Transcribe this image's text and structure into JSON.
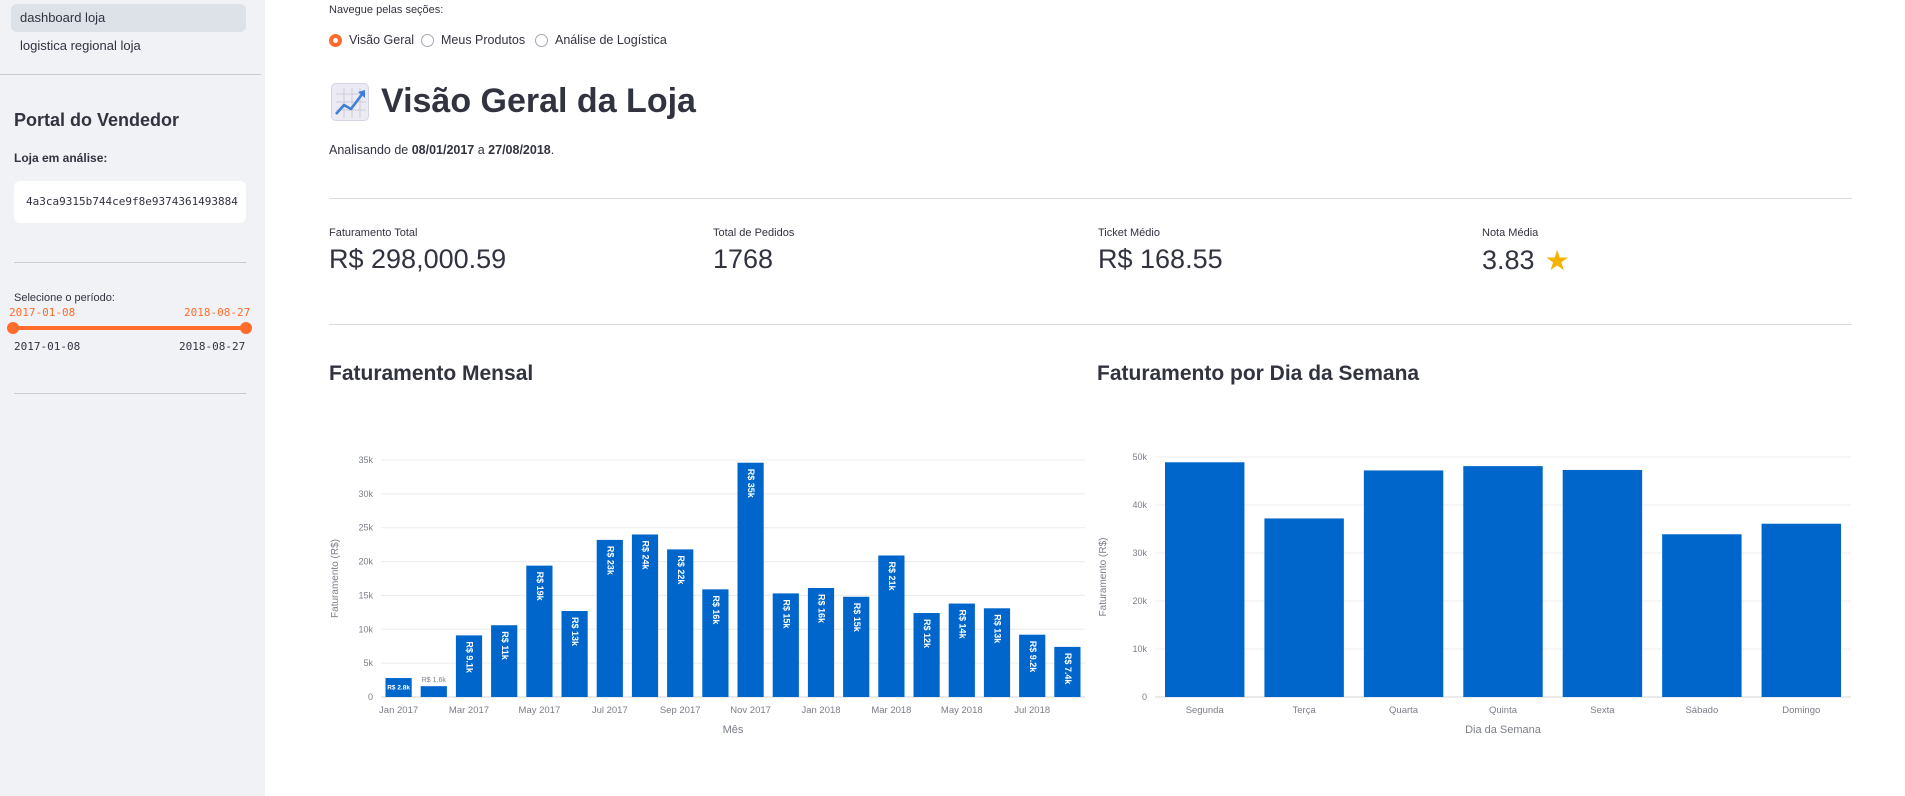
{
  "sidebar": {
    "nav": [
      "dashboard loja",
      "logistica regional loja"
    ],
    "portal_title": "Portal do Vendedor",
    "store_label": "Loja em análise:",
    "store_id": "4a3ca9315b744ce9f8e9374361493884",
    "period_label": "Selecione o período:",
    "slider": {
      "start": "2017-01-08",
      "end": "2018-08-27",
      "min": "2017-01-08",
      "max": "2018-08-27"
    }
  },
  "main": {
    "nav_hint": "Navegue pelas seções:",
    "sections": [
      "Visão Geral",
      "Meus Produtos",
      "Análise de Logística"
    ],
    "selected_section": "Visão Geral",
    "title": "Visão Geral da Loja",
    "period_prefix": "Analisando de ",
    "period_start": "08/01/2017",
    "period_mid": " a ",
    "period_end": "27/08/2018",
    "period_suffix": ".",
    "metrics": [
      {
        "label": "Faturamento Total",
        "value": "R$ 298,000.59"
      },
      {
        "label": "Total de Pedidos",
        "value": "1768"
      },
      {
        "label": "Ticket Médio",
        "value": "R$ 168.55"
      },
      {
        "label": "Nota Média",
        "value": "3.83"
      }
    ],
    "chart_titles": [
      "Faturamento Mensal",
      "Faturamento por Dia da Semana"
    ]
  },
  "colors": {
    "accent": "#ff6c2c",
    "bar": "#0066cc",
    "sidebar_bg": "#f0f2f6"
  },
  "icons": {
    "title_icon": "chart-increasing-icon",
    "rating_icon": "star-icon"
  },
  "chart_data": [
    {
      "type": "bar",
      "title": "Faturamento Mensal",
      "xlabel": "Mês",
      "ylabel": "Faturamento (R$)",
      "ylim": [
        0,
        35000
      ],
      "yticks": [
        0,
        5000,
        10000,
        15000,
        20000,
        25000,
        30000,
        35000
      ],
      "ytick_labels": [
        "0",
        "5k",
        "10k",
        "15k",
        "20k",
        "25k",
        "30k",
        "35k"
      ],
      "categories": [
        "2017-01",
        "2017-02",
        "2017-03",
        "2017-04",
        "2017-05",
        "2017-06",
        "2017-07",
        "2017-08",
        "2017-09",
        "2017-10",
        "2017-11",
        "2017-12",
        "2018-01",
        "2018-02",
        "2018-03",
        "2018-04",
        "2018-05",
        "2018-06",
        "2018-07",
        "2018-08"
      ],
      "xtick_labels": [
        "Jan 2017",
        "",
        "Mar 2017",
        "",
        "May 2017",
        "",
        "Jul 2017",
        "",
        "Sep 2017",
        "",
        "Nov 2017",
        "",
        "Jan 2018",
        "",
        "Mar 2018",
        "",
        "May 2018",
        "",
        "Jul 2018",
        ""
      ],
      "values": [
        2800,
        1600,
        9100,
        10600,
        19400,
        12700,
        23200,
        24000,
        21800,
        15900,
        34600,
        15300,
        16100,
        14800,
        20900,
        12400,
        13800,
        13100,
        9200,
        7400
      ],
      "data_labels": [
        "R$ 2.8k",
        "R$ 1.6k",
        "R$ 9.1k",
        "R$ 11k",
        "R$ 19k",
        "R$ 13k",
        "R$ 23k",
        "R$ 24k",
        "R$ 22k",
        "R$ 16k",
        "R$ 35k",
        "R$ 15k",
        "R$ 16k",
        "R$ 15k",
        "R$ 21k",
        "R$ 12k",
        "R$ 14k",
        "R$ 13k",
        "R$ 9.2k",
        "R$ 7.4k"
      ],
      "grid": true
    },
    {
      "type": "bar",
      "title": "Faturamento por Dia da Semana",
      "xlabel": "Dia da Semana",
      "ylabel": "Faturamento (R$)",
      "ylim": [
        0,
        50000
      ],
      "yticks": [
        0,
        10000,
        20000,
        30000,
        40000,
        50000
      ],
      "ytick_labels": [
        "0",
        "10k",
        "20k",
        "30k",
        "40k",
        "50k"
      ],
      "categories": [
        "Segunda",
        "Terça",
        "Quarta",
        "Quinta",
        "Sexta",
        "Sábado",
        "Domingo"
      ],
      "values": [
        48900,
        37200,
        47200,
        48100,
        47300,
        33900,
        36100
      ],
      "grid": true
    }
  ]
}
